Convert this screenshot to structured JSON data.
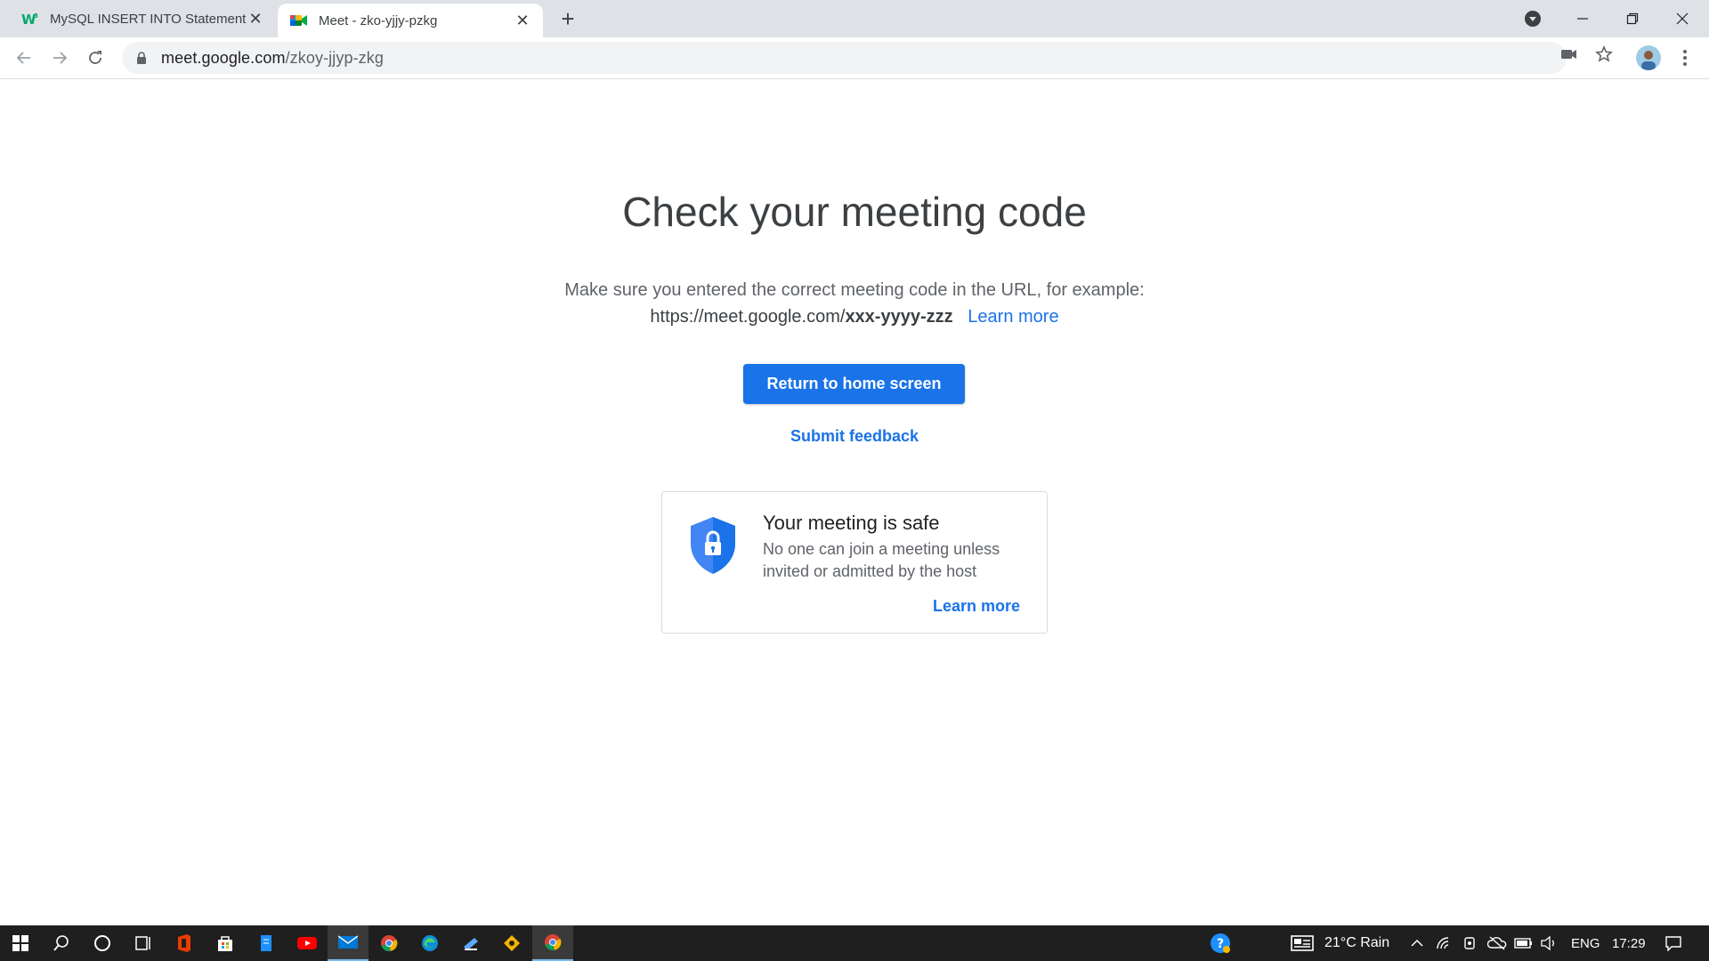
{
  "browser": {
    "tabs": [
      {
        "title": "MySQL INSERT INTO Statement",
        "favicon": "w3schools-icon",
        "active": false
      },
      {
        "title": "Meet - zko-yjjy-pzkg",
        "favicon": "google-meet-icon",
        "active": true
      }
    ],
    "new_tab": "+",
    "url_host": "meet.google.com",
    "url_path": "/zkoy-jjyp-zkg"
  },
  "main": {
    "title": "Check your meeting code",
    "description": "Make sure you entered the correct meeting code in the URL, for example:",
    "example_prefix": "https://meet.google.com/",
    "example_code": "xxx-yyyy-zzz",
    "learn_more": "Learn more",
    "return_button": "Return to home screen",
    "submit_feedback": "Submit feedback"
  },
  "safe_card": {
    "title": "Your meeting is safe",
    "body": "No one can join a meeting unless invited or admitted by the host",
    "learn_more": "Learn more"
  },
  "taskbar": {
    "weather": "21°C  Rain",
    "language": "ENG",
    "time": "17:29"
  },
  "colors": {
    "accent": "#1a73e8",
    "tabstrip": "#dee1e6",
    "taskbar": "#1f1f1f"
  }
}
